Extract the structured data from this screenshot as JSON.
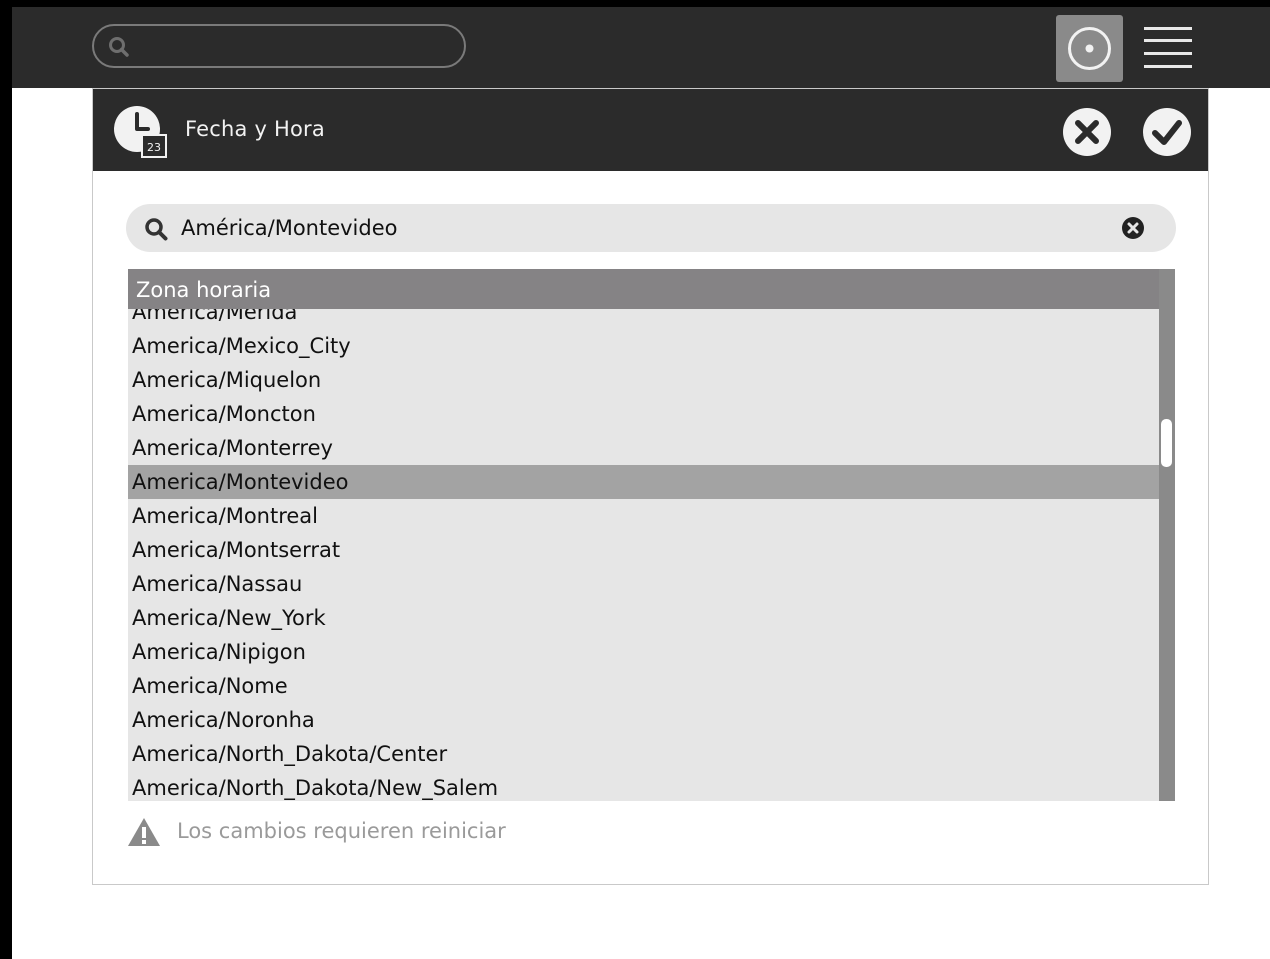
{
  "topbar": {
    "search_placeholder": "",
    "icons": {
      "search": "search-icon",
      "home": "circle-dot-icon",
      "menu": "hamburger-menu-icon"
    }
  },
  "dialog": {
    "title": "Fecha y Hora",
    "clock_badge": "23",
    "search": {
      "value": "América/Montevideo"
    },
    "list": {
      "header": "Zona horaria",
      "items": [
        "America/Merida",
        "America/Mexico_City",
        "America/Miquelon",
        "America/Moncton",
        "America/Monterrey",
        "America/Montevideo",
        "America/Montreal",
        "America/Montserrat",
        "America/Nassau",
        "America/New_York",
        "America/Nipigon",
        "America/Nome",
        "America/Noronha",
        "America/North_Dakota/Center",
        "America/North_Dakota/New_Salem"
      ],
      "selected": "America/Montevideo"
    },
    "warning": "Los cambios requieren reiniciar"
  },
  "colors": {
    "bar": "#2b2b2b",
    "list_bg": "#e6e6e6",
    "selected": "#a3a3a3",
    "header": "#858385"
  }
}
